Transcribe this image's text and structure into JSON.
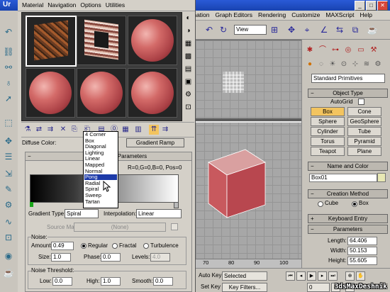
{
  "app_window": {
    "title": "Ur",
    "menu": [
      "mation",
      "Graph Editors",
      "Rendering",
      "Customize",
      "MAXScript",
      "Help"
    ],
    "view_select": "View"
  },
  "viewport": {
    "ruler_ticks": [
      "70",
      "80",
      "90",
      "100"
    ]
  },
  "time_controls": {
    "auto_key": "Auto Key",
    "selected": "Selected",
    "set_key": "Set Key",
    "key_filters": "Key Filters...",
    "frame": "0"
  },
  "command_panel": {
    "category": "Standard Primitives",
    "object_type_title": "Object Type",
    "autogrid": "AutoGrid",
    "buttons": [
      "Box",
      "Cone",
      "Sphere",
      "GeoSphere",
      "Cylinder",
      "Tube",
      "Torus",
      "Pyramid",
      "Teapot",
      "Plane"
    ],
    "active_button": "Box",
    "name_color_title": "Name and Color",
    "object_name": "Box01",
    "object_color": "#e8e8b4",
    "creation_method_title": "Creation Method",
    "creation_cube": "Cube",
    "creation_box": "Box",
    "keyboard_entry": "Keyboard Entry",
    "parameters_title": "Parameters",
    "length_label": "Length:",
    "length": "64.406",
    "width_label": "Width:",
    "width": "50.153",
    "height_label": "Height:",
    "height": "55.605"
  },
  "material_editor": {
    "menu": [
      "Material",
      "Navigation",
      "Options",
      "Utilities"
    ],
    "diffuse_label": "Diffuse Color:",
    "map_type": "Gradient Ramp",
    "rollout_title": "amp Parameters",
    "rgb_readout": "R=0,G=0,B=0, Pos=0",
    "gradient_type_label": "Gradient Type:",
    "gradient_type": "Spiral",
    "interpolation_label": "Interpolation:",
    "interpolation": "Linear",
    "source_map_label": "Source Map:",
    "source_map": "(None)",
    "noise_group": "Noise:",
    "amount_label": "Amount:",
    "amount": "0.49",
    "regular": "Regular",
    "fractal": "Fractal",
    "turbulence": "Turbulence",
    "size_label": "Size:",
    "size": "1.0",
    "phase_label": "Phase:",
    "phase": "0.0",
    "levels_label": "Levels:",
    "levels": "4.0",
    "noise_threshold_group": "Noise Threshold:",
    "low_label": "Low:",
    "low": "0.0",
    "high_label": "High:",
    "high": "1.0",
    "smooth_label": "Smooth:",
    "smooth": "0.0"
  },
  "gradient_type_options": [
    "4 Corner",
    "Box",
    "Diagonal",
    "Lighting",
    "Linear",
    "Mapped",
    "Normal",
    "Pong",
    "Radial",
    "Spiral",
    "Sweep",
    "Tartan"
  ],
  "highlighted_option": "Pong",
  "watermark": "3dsMaxDeshnik"
}
